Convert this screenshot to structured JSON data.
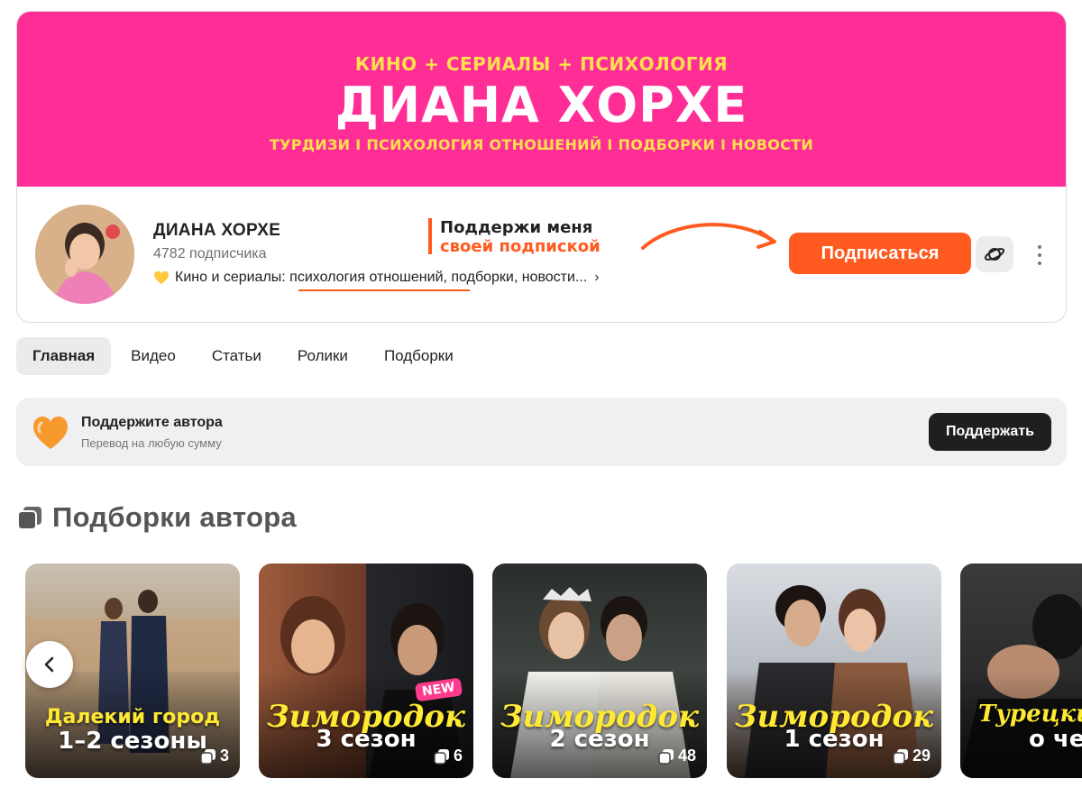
{
  "banner": {
    "top_line": "КИНО + СЕРИАЛЫ + ПСИХОЛОГИЯ",
    "title": "ДИАНА ХОРХЕ",
    "sub_line": "ТУРДИЗИ I ПСИХОЛОГИЯ ОТНОШЕНИЙ I ПОДБОРКИ I НОВОСТИ",
    "bg_color": "#ff2d96",
    "accent_color": "#ffe14d"
  },
  "channel": {
    "name": "ДИАНА ХОРХЕ",
    "subscribers": "4782 подписчика",
    "description": "Кино и сериалы: психология отношений, подборки, новости...",
    "description_icon": "yellow-heart-icon"
  },
  "promo": {
    "line1": "Поддержи меня",
    "line2": "своей подпиской",
    "accent_color": "#ff5a1f"
  },
  "actions": {
    "subscribe_label": "Подписаться",
    "planet_icon": "planet-icon",
    "more_icon": "more-vertical-icon"
  },
  "tabs": [
    {
      "label": "Главная",
      "active": true
    },
    {
      "label": "Видео",
      "active": false
    },
    {
      "label": "Статьи",
      "active": false
    },
    {
      "label": "Ролики",
      "active": false
    },
    {
      "label": "Подборки",
      "active": false
    }
  ],
  "support": {
    "title": "Поддержите автора",
    "subtitle": "Перевод на любую сумму",
    "button_label": "Поддержать",
    "icon": "orange-heart-icon"
  },
  "collections": {
    "title": "Подборки автора",
    "icon": "collection-icon",
    "items": [
      {
        "line1": "Далекий город",
        "line2": "1–2 сезоны",
        "count": "3",
        "badge": ""
      },
      {
        "line1": "Зимородок",
        "line2": "3 сезон",
        "count": "6",
        "badge": "NEW"
      },
      {
        "line1": "Зимородок",
        "line2": "2 сезон",
        "count": "48",
        "badge": ""
      },
      {
        "line1": "Зимородок",
        "line2": "1 сезон",
        "count": "29",
        "badge": ""
      },
      {
        "line1": "Турецкие с",
        "line2": "о чем",
        "count": "",
        "badge": ""
      }
    ]
  }
}
